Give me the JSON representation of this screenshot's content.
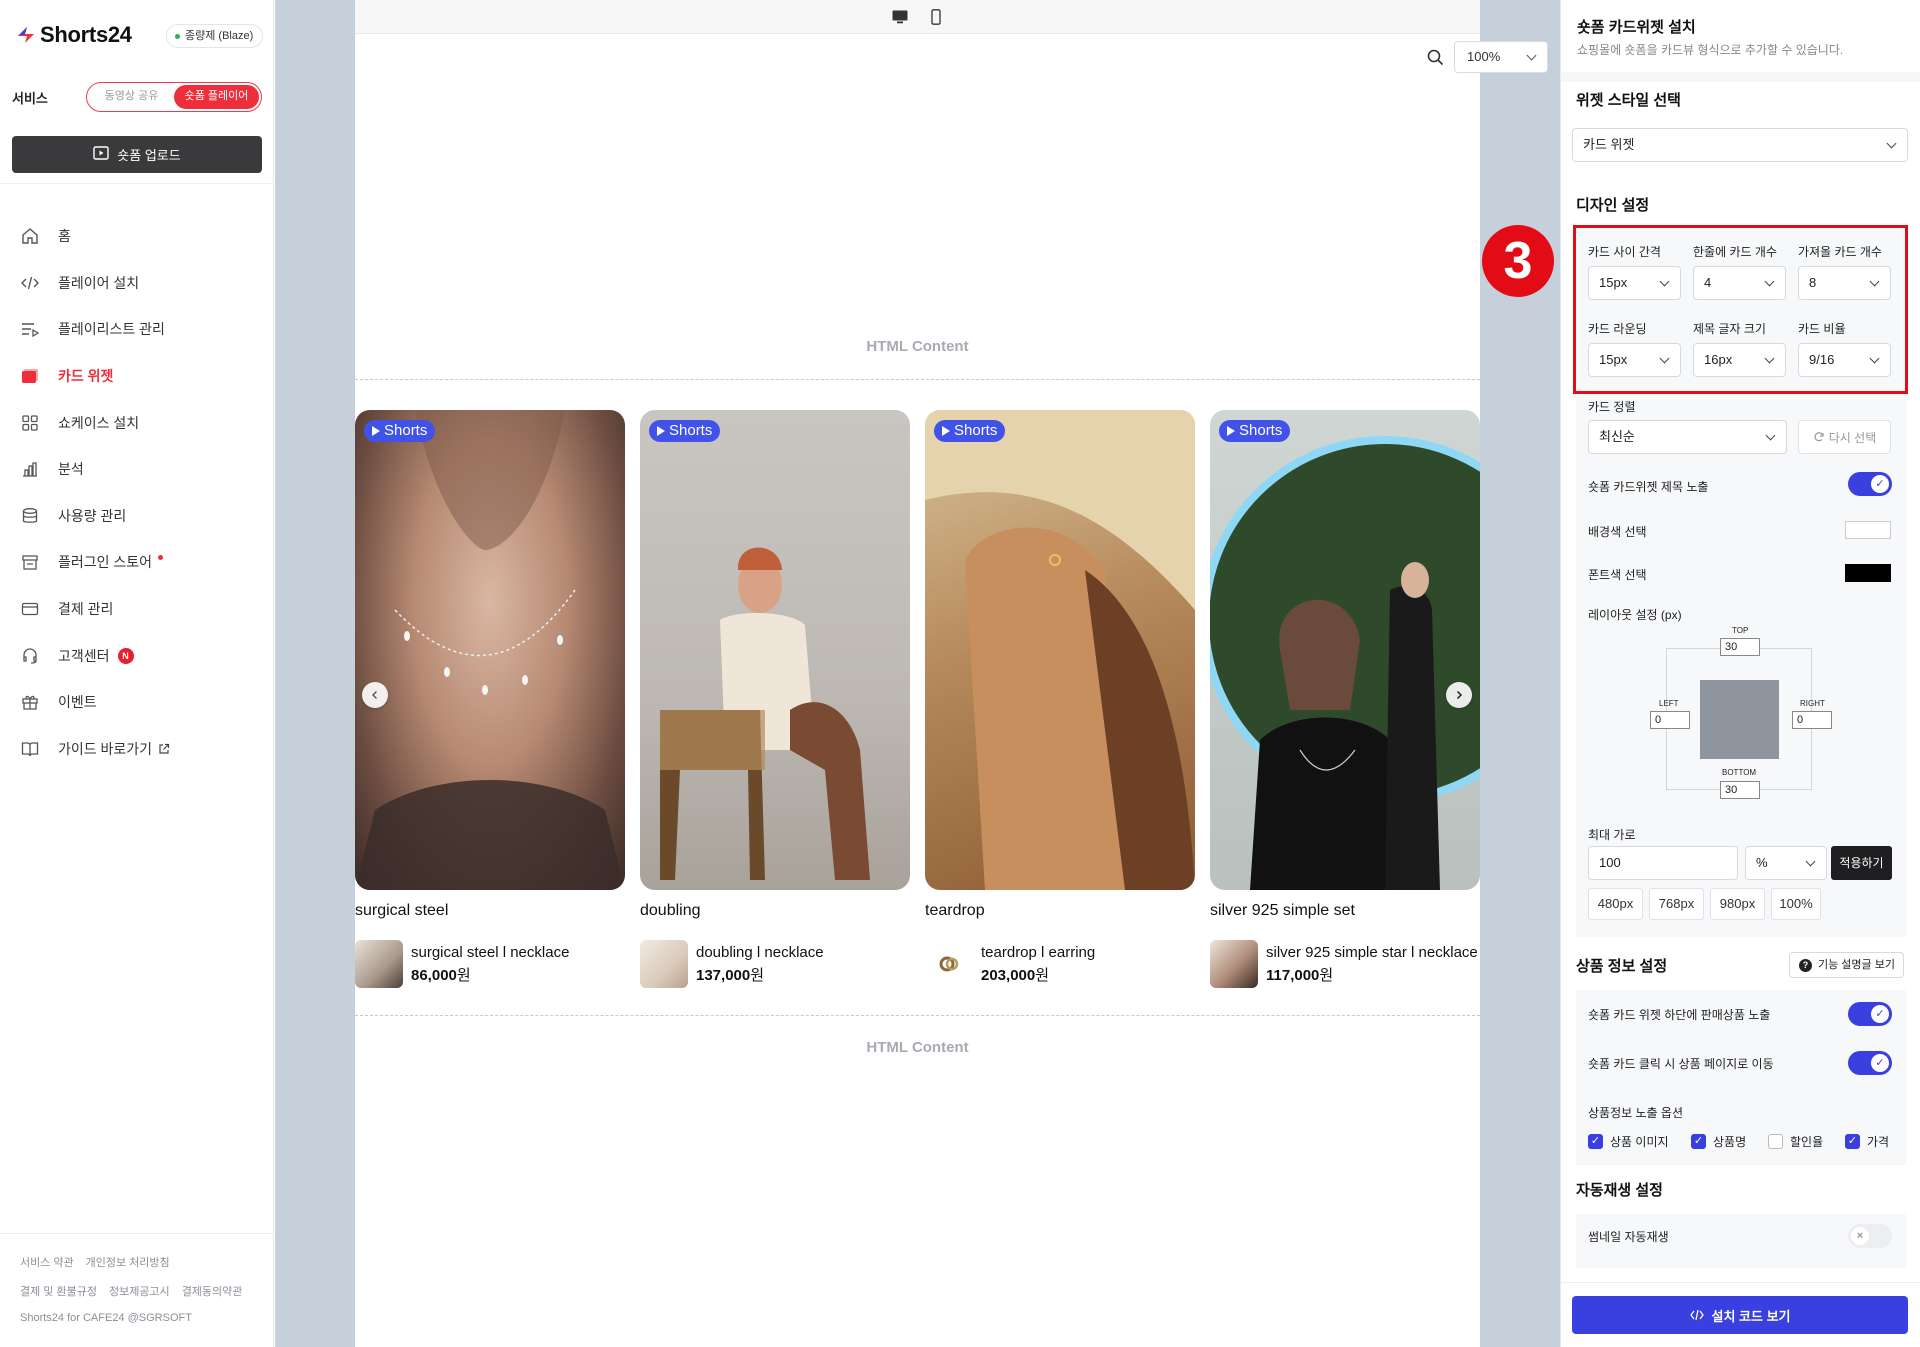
{
  "brand": {
    "name": "Shorts24",
    "plan": "종량제 (Blaze)"
  },
  "service": {
    "label": "서비스",
    "options": [
      "동영상 공유",
      "숏폼 플레이어"
    ],
    "selected": "숏폼 플레이어"
  },
  "upload_button": "숏폼 업로드",
  "nav": [
    {
      "label": "홈",
      "icon": "home-icon"
    },
    {
      "label": "플레이어 설치",
      "icon": "code-icon"
    },
    {
      "label": "플레이리스트 관리",
      "icon": "playlist-icon"
    },
    {
      "label": "카드 위젯",
      "icon": "card-widget-icon",
      "active": true
    },
    {
      "label": "쇼케이스 설치",
      "icon": "grid-icon"
    },
    {
      "label": "분석",
      "icon": "bar-chart-icon"
    },
    {
      "label": "사용량 관리",
      "icon": "database-icon"
    },
    {
      "label": "플러그인 스토어",
      "icon": "store-icon",
      "dot": true
    },
    {
      "label": "결제 관리",
      "icon": "credit-card-icon"
    },
    {
      "label": "고객센터",
      "icon": "headset-icon",
      "badge": "N"
    },
    {
      "label": "이벤트",
      "icon": "gift-icon"
    },
    {
      "label": "가이드 바로가기",
      "icon": "book-icon",
      "external": true
    }
  ],
  "footer": {
    "links_row1": [
      "서비스 약관",
      "개인정보 처리방침"
    ],
    "links_row2": [
      "결제 및 환불규정",
      "정보제공고시",
      "결제동의약관"
    ],
    "copyright": "Shorts24 for CAFE24 @SGRSOFT"
  },
  "preview": {
    "zoom": "100%",
    "html_content_label": "HTML Content",
    "tag_label": "Shorts",
    "cards": [
      {
        "title": "surgical steel",
        "product": "surgical steel l necklace",
        "price": "86,000",
        "currency": "원"
      },
      {
        "title": "doubling",
        "product": "doubling l necklace",
        "price": "137,000",
        "currency": "원"
      },
      {
        "title": "teardrop",
        "product": "teardrop l earring",
        "price": "203,000",
        "currency": "원"
      },
      {
        "title": "silver 925 simple set",
        "product": "silver 925 simple star l necklace",
        "price": "117,000",
        "currency": "원"
      }
    ]
  },
  "panel": {
    "title": "숏폼 카드위젯 설치",
    "subtitle": "쇼핑몰에 숏폼을 카드뷰 형식으로 추가할 수 있습니다.",
    "widget_style": {
      "heading": "위젯 스타일 선택",
      "value": "카드 위젯"
    },
    "design": {
      "heading": "디자인 설정",
      "step_number": "3",
      "fields": [
        {
          "label": "카드 사이 간격",
          "value": "15px"
        },
        {
          "label": "한줄에 카드 개수",
          "value": "4"
        },
        {
          "label": "가져올 카드 개수",
          "value": "8"
        },
        {
          "label": "카드 라운딩",
          "value": "15px"
        },
        {
          "label": "제목 글자 크기",
          "value": "16px"
        },
        {
          "label": "카드 비율",
          "value": "9/16"
        }
      ],
      "sort": {
        "label": "카드 정렬",
        "value": "최신순",
        "reset": "다시 선택"
      },
      "title_visible": {
        "label": "숏폼 카드위젯 제목 노출",
        "on": true
      },
      "bg_color": {
        "label": "배경색 선택",
        "value": "#ffffff"
      },
      "font_color": {
        "label": "폰트색 선택",
        "value": "#000000"
      },
      "layout": {
        "label": "레이아웃 설정 (px)",
        "top_label": "TOP",
        "top": "30",
        "left_label": "LEFT",
        "left": "0",
        "right_label": "RIGHT",
        "right": "0",
        "bottom_label": "BOTTOM",
        "bottom": "30"
      },
      "max_width": {
        "label": "최대 가로",
        "value": "100",
        "unit": "%",
        "apply": "적용하기",
        "presets": [
          "480px",
          "768px",
          "980px",
          "100%"
        ]
      }
    },
    "product_info": {
      "heading": "상품 정보 설정",
      "help_button": "기능 설명글 보기",
      "show_products": {
        "label": "숏폼 카드 위젯 하단에 판매상품 노출",
        "on": true
      },
      "link_to_product": {
        "label": "숏폼 카드 클릭 시 상품 페이지로 이동",
        "on": true
      },
      "options_label": "상품정보 노출 옵션",
      "options": [
        {
          "label": "상품 이미지",
          "checked": true
        },
        {
          "label": "상품명",
          "checked": true
        },
        {
          "label": "할인율",
          "checked": false
        },
        {
          "label": "가격",
          "checked": true
        }
      ]
    },
    "autoplay": {
      "heading": "자동재생 설정",
      "thumbnail_autoplay": {
        "label": "썸네일 자동재생",
        "on": false
      }
    },
    "install_button": "설치 코드 보기"
  },
  "colors": {
    "brand_red": "#ef2e3c",
    "primary_blue": "#3a3fe0",
    "highlight_red": "#e30b16",
    "shorts_tag": "#4052e8"
  }
}
